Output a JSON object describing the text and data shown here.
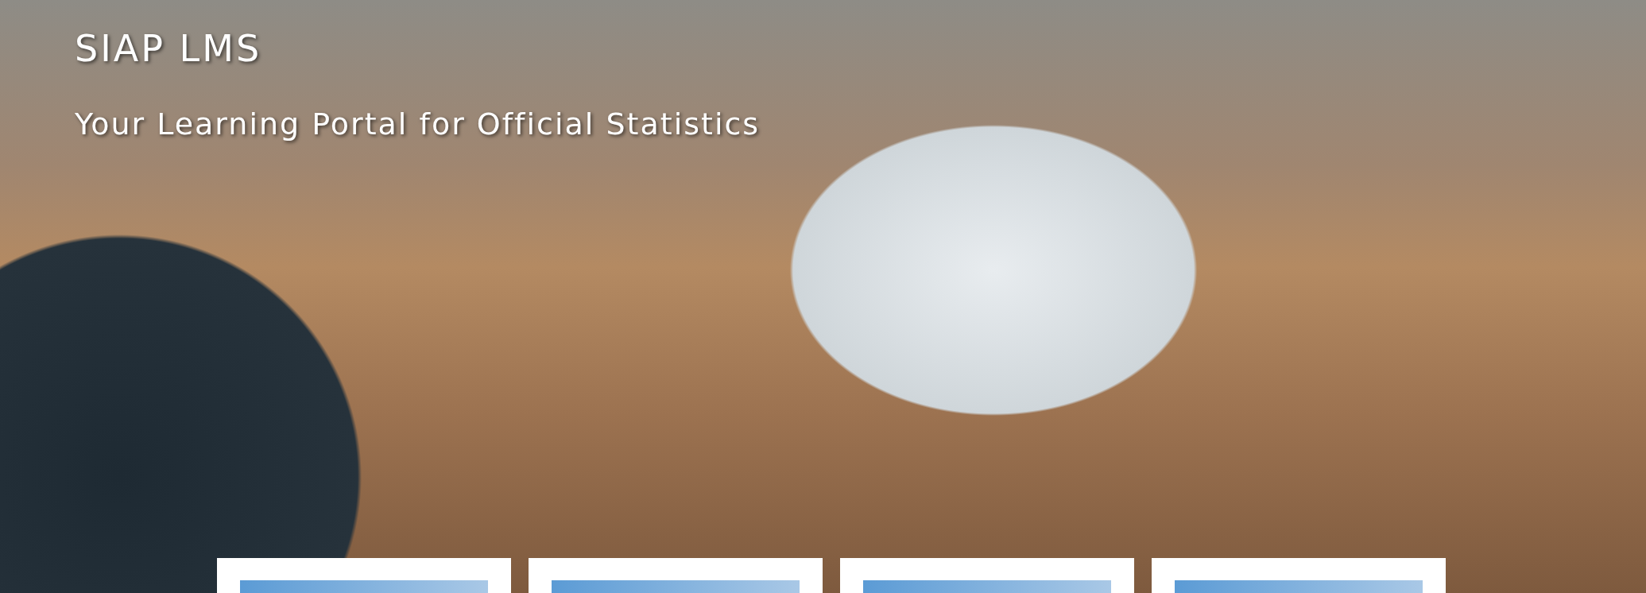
{
  "hero": {
    "title": "SIAP LMS",
    "subtitle": "Your Learning Portal for Official Statistics"
  },
  "cards": [
    {
      "kind": "photo"
    },
    {
      "kind": "photo"
    },
    {
      "kind": "photo"
    },
    {
      "kind": "photo"
    }
  ]
}
